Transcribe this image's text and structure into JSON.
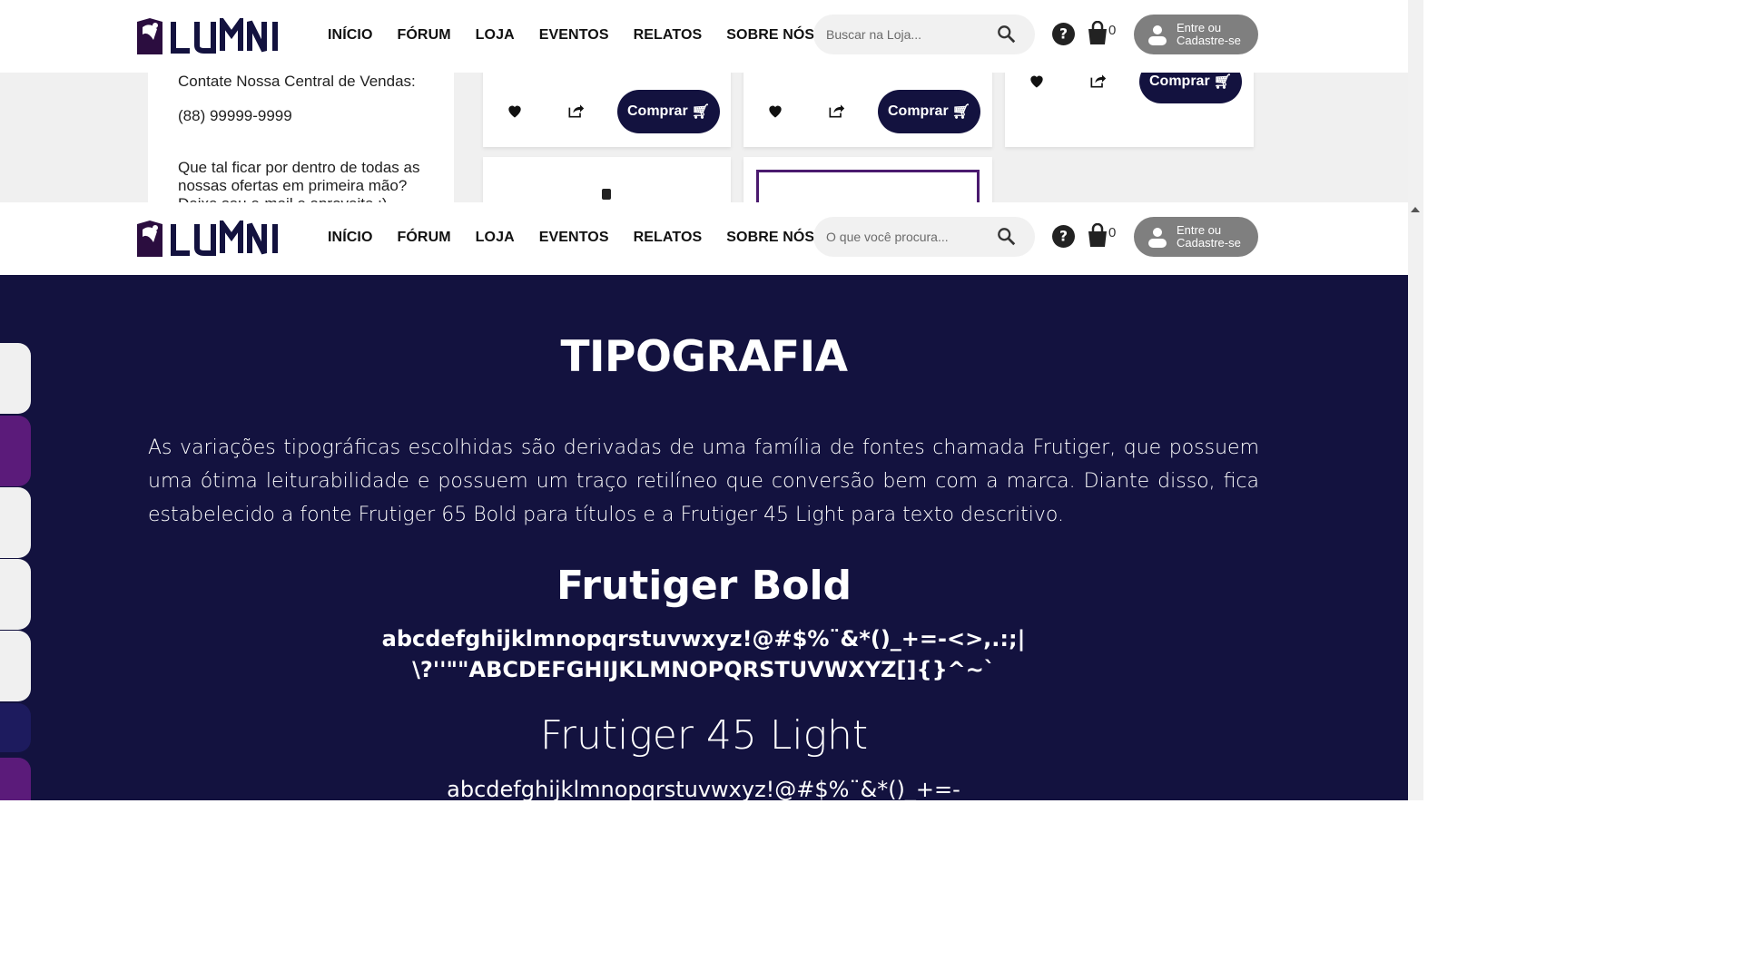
{
  "brand": {
    "accent": "#13123f",
    "purple": "#5b1b7a",
    "logo_text": "LUMNI"
  },
  "nav": {
    "links": [
      "INÍCIO",
      "FÓRUM",
      "LOJA",
      "EVENTOS",
      "RELATOS",
      "SOBRE NÓS"
    ],
    "cart_count": "0",
    "login_line1": "Entre ou",
    "login_line2": "Cadastre-se"
  },
  "top_pane": {
    "search_placeholder": "Buscar na Loja...",
    "contact": {
      "heading": "Contate Nossa Central de Vendas:",
      "phone": "(88) 99999-9999",
      "newsletter_line1": "Que tal ficar por dentro de todas as",
      "newsletter_line2": "nossas ofertas em primeira mão?",
      "newsletter_line3": "Deixe seu e-mail e aproveite :)"
    },
    "buy_label": "Comprar"
  },
  "bottom_pane": {
    "search_placeholder": "O que você procura...",
    "title": "TIPOGRAFIA",
    "description": "As variações tipográficas escolhidas são derivadas de uma família de fontes chamada Frutiger, que possuem uma ótima leiturabilidade e possuem um traço retilíneo que conversão bem com a marca. Diante disso, fica estabelecido a fonte Frutiger 65 Bold para títulos e a Frutiger 45 Light para texto descritivo.",
    "bold_title": "Frutiger Bold",
    "bold_sample": "abcdefghijklmnopqrstuvwxyz!@#$%¨&*()_+=-<>,.:;|\\?''\"\"ABCDEFGHIJKLMNOPQRSTUVWXYZ[]{}^~`",
    "light_title": "Frutiger 45 Light",
    "light_sample": "abcdefghijklmnopqrstuvwxyz!@#$%¨&*()_+=-",
    "side_tab_colors": [
      "#f0f0f0",
      "#5b1b7a",
      "#f0f0f0",
      "#f0f0f0",
      "#f0f0f0",
      "#1d1b5e",
      "#5b1b7a"
    ]
  }
}
